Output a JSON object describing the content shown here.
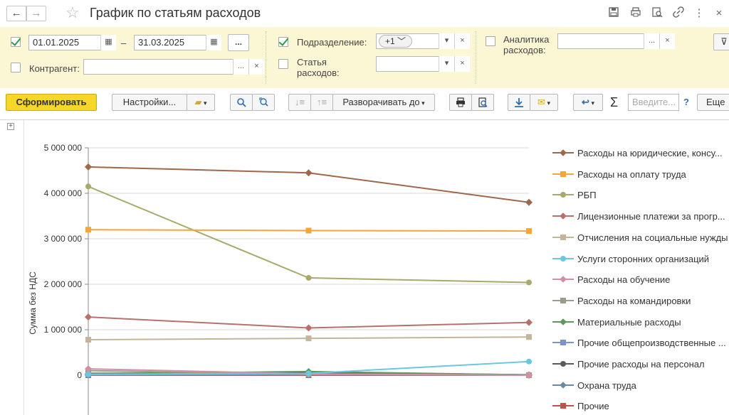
{
  "window": {
    "title": "График по статьям расходов",
    "back_icon": "←",
    "forward_icon": "→"
  },
  "filters": {
    "period_enabled": true,
    "date_from": "01.01.2025",
    "date_sep": "–",
    "date_to": "31.03.2025",
    "period_more": "...",
    "division_label": "Подразделение:",
    "division_tag": "+1",
    "expense_item_label": "Статья расходов:",
    "expense_item_value": "",
    "counterparty_label": "Контрагент:",
    "counterparty_value": "",
    "analytics_label": "Аналитика расходов:",
    "analytics_value": "",
    "more_btn": "...",
    "clear_btn": "×",
    "dropdown_btn": "▾"
  },
  "toolbar": {
    "generate": "Сформировать",
    "settings": "Настройки...",
    "expand_to": "Разворачивать до",
    "search_placeholder": "Введите...",
    "help": "?",
    "more": "Еще",
    "sigma": "Σ"
  },
  "chart_data": {
    "type": "line",
    "ylabel": "Сумма без НДС",
    "xlabel": "",
    "ylim": [
      0,
      5000000
    ],
    "yticks": [
      0,
      1000000,
      2000000,
      3000000,
      4000000,
      5000000
    ],
    "ytick_labels": [
      "0",
      "1 000 000",
      "2 000 000",
      "3 000 000",
      "4 000 000",
      "5 000 000"
    ],
    "x": [
      1,
      2,
      3
    ],
    "series": [
      {
        "name": "Расходы на юридические, консу...",
        "color": "#a0674a",
        "marker": "diamond",
        "values": [
          4580000,
          4450000,
          3800000
        ]
      },
      {
        "name": "Расходы на оплату труда",
        "color": "#f6a53a",
        "marker": "square",
        "values": [
          3200000,
          3180000,
          3170000
        ]
      },
      {
        "name": "РБП",
        "color": "#a8a96a",
        "marker": "circle",
        "values": [
          4150000,
          2140000,
          2040000
        ]
      },
      {
        "name": "Лицензионные платежи за прогр...",
        "color": "#b8706a",
        "marker": "diamond",
        "values": [
          1280000,
          1040000,
          1160000
        ]
      },
      {
        "name": "Отчисления на социальные нужды",
        "color": "#c4b59a",
        "marker": "square",
        "values": [
          780000,
          810000,
          840000
        ]
      },
      {
        "name": "Услуги сторонних организаций",
        "color": "#6ac7e0",
        "marker": "circle",
        "values": [
          20000,
          40000,
          300000
        ]
      },
      {
        "name": "Расходы на обучение",
        "color": "#d58ea6",
        "marker": "diamond",
        "values": [
          140000,
          30000,
          0
        ]
      },
      {
        "name": "Расходы на командировки",
        "color": "#9c9c8a",
        "marker": "square",
        "values": [
          100000,
          20000,
          0
        ]
      },
      {
        "name": "Материальные расходы",
        "color": "#5a9a5a",
        "marker": "diamond",
        "values": [
          30000,
          80000,
          5000
        ]
      },
      {
        "name": "Прочие общепроизводственные ...",
        "color": "#7b93c9",
        "marker": "square",
        "values": [
          10000,
          20000,
          0
        ]
      },
      {
        "name": "Прочие расходы на персонал",
        "color": "#5a5a5a",
        "marker": "circle",
        "values": [
          40000,
          60000,
          10000
        ]
      },
      {
        "name": "Охрана труда",
        "color": "#6a8aa0",
        "marker": "diamond",
        "values": [
          5000,
          10000,
          0
        ]
      },
      {
        "name": "Прочие",
        "color": "#c0504d",
        "marker": "square",
        "values": [
          0,
          0,
          0
        ]
      }
    ]
  }
}
